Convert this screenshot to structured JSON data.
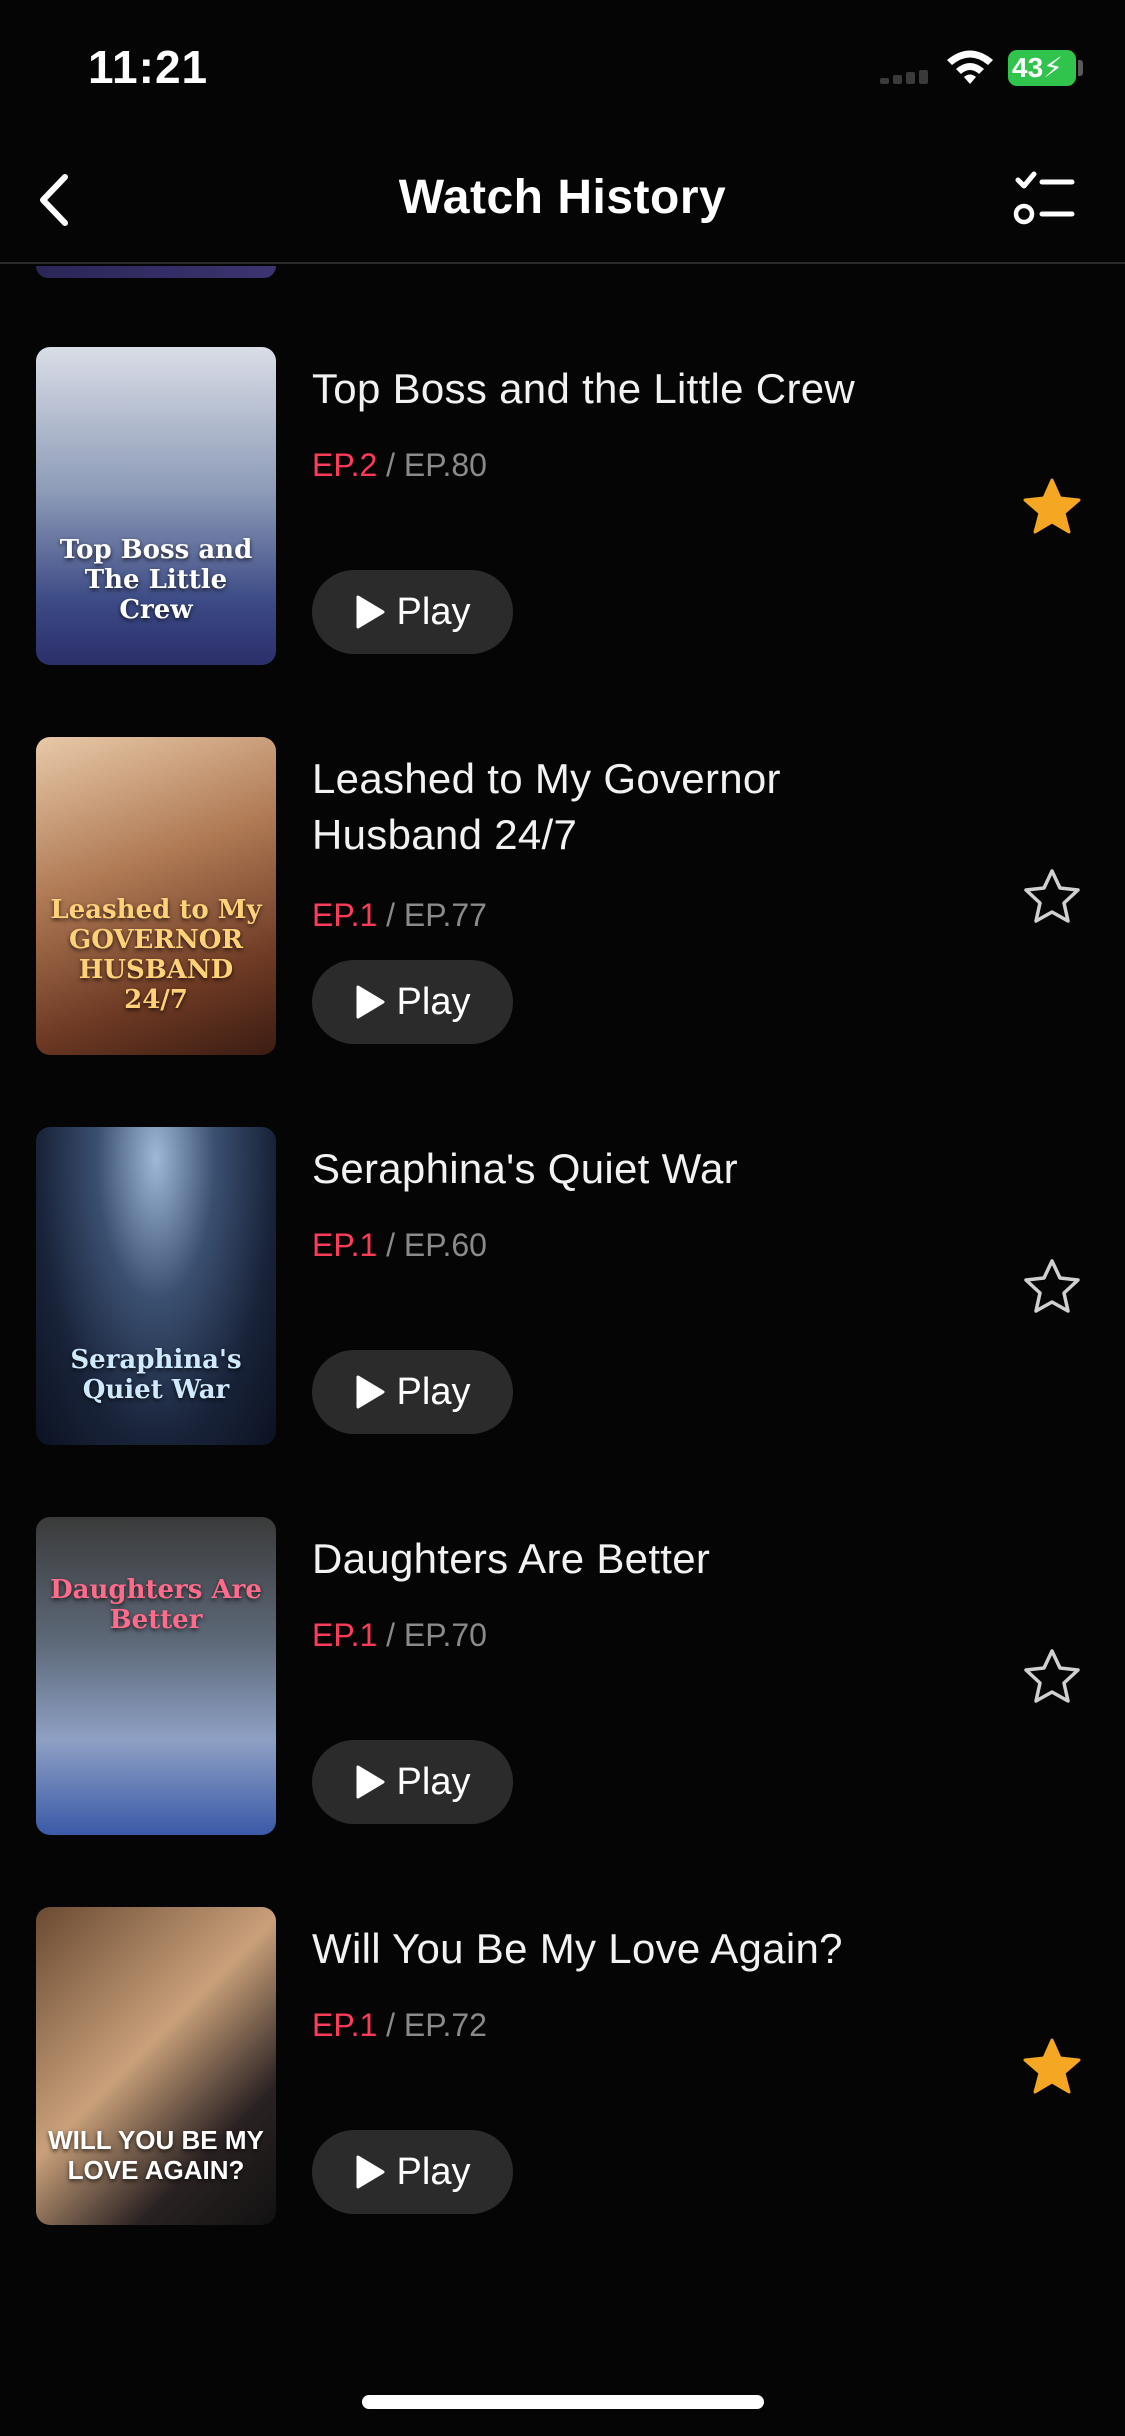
{
  "status_bar": {
    "time": "11:21",
    "battery": "43"
  },
  "header": {
    "title": "Watch History",
    "back_icon": "chevron-left-icon",
    "edit_icon": "checklist-icon"
  },
  "colors": {
    "accent_episode": "#ff3b5a",
    "favorite_star": "#f5a623",
    "background": "#050505"
  },
  "items": [
    {
      "title": "Top Boss and the Little Crew",
      "ep_current": "EP.2",
      "ep_total": " / EP.80",
      "play_label": "Play",
      "favorited": true,
      "poster_text": "Top Boss and The Little Crew"
    },
    {
      "title": "Leashed to My Governor Husband 24/7",
      "ep_current": "EP.1",
      "ep_total": " / EP.77",
      "play_label": "Play",
      "favorited": false,
      "poster_text": "Leashed to My GOVERNOR HUSBAND 24/7"
    },
    {
      "title": "Seraphina's Quiet War",
      "ep_current": "EP.1",
      "ep_total": " / EP.60",
      "play_label": "Play",
      "favorited": false,
      "poster_text": "Seraphina's Quiet War"
    },
    {
      "title": "Daughters Are Better",
      "ep_current": "EP.1",
      "ep_total": " / EP.70",
      "play_label": "Play",
      "favorited": false,
      "poster_text": "Daughters Are Better"
    },
    {
      "title": "Will You Be My Love Again?",
      "ep_current": "EP.1",
      "ep_total": " / EP.72",
      "play_label": "Play",
      "favorited": true,
      "poster_text": "WILL YOU BE MY LOVE AGAIN?"
    }
  ]
}
